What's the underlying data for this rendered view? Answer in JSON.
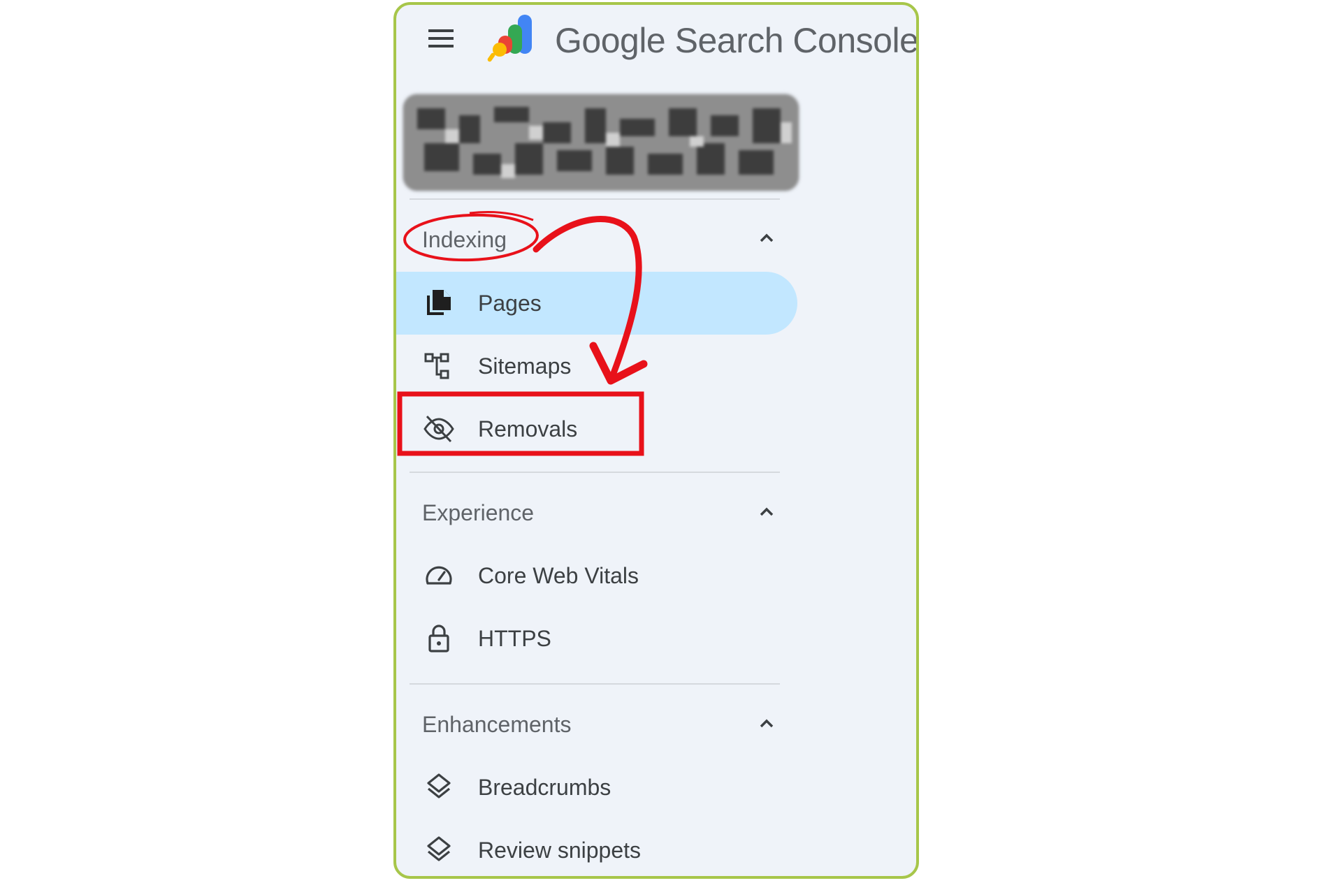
{
  "app": {
    "title": "Google Search Console"
  },
  "property": {
    "label": ""
  },
  "sections": [
    {
      "title": "Indexing",
      "items": [
        {
          "label": "Pages",
          "icon": "pages-icon",
          "active": true
        },
        {
          "label": "Sitemaps",
          "icon": "sitemap-icon"
        },
        {
          "label": "Removals",
          "icon": "eye-off-icon"
        }
      ]
    },
    {
      "title": "Experience",
      "items": [
        {
          "label": "Core Web Vitals",
          "icon": "speed-gauge-icon"
        },
        {
          "label": "HTTPS",
          "icon": "lock-icon"
        }
      ]
    },
    {
      "title": "Enhancements",
      "items": [
        {
          "label": "Breadcrumbs",
          "icon": "layers-icon"
        },
        {
          "label": "Review snippets",
          "icon": "layers-icon"
        }
      ]
    }
  ],
  "colors": {
    "frame_border": "#a7c64a",
    "sidebar_bg": "#eff3f9",
    "active_bg": "#c2e7ff",
    "annotation_red": "#e8111a"
  }
}
